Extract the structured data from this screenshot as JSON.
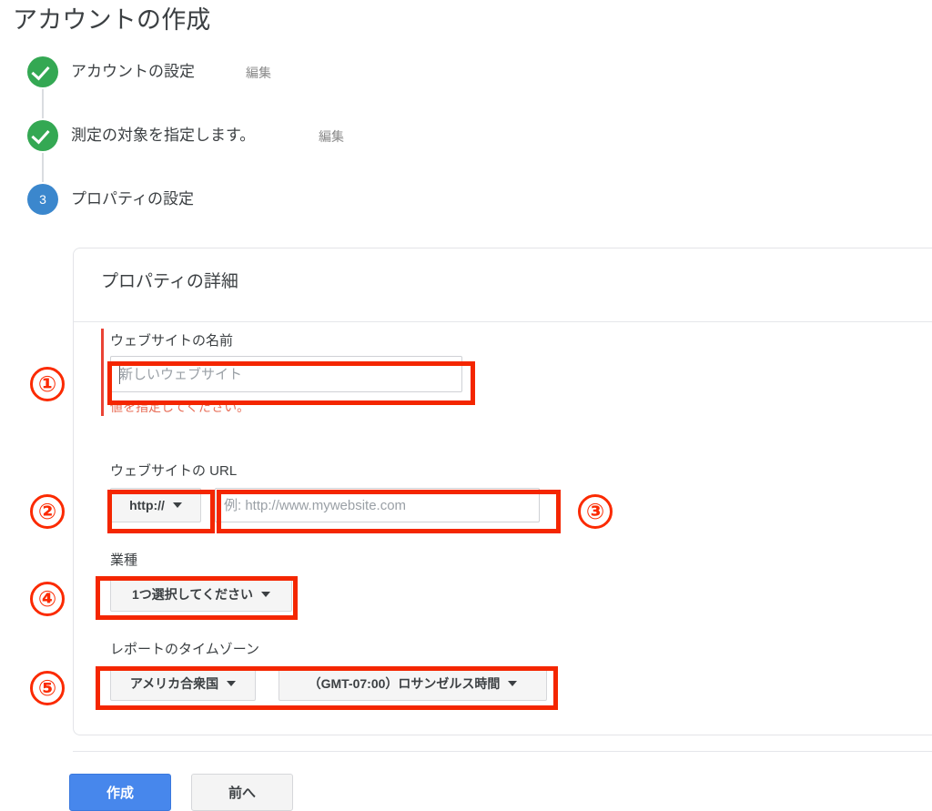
{
  "page": {
    "title": "アカウントの作成"
  },
  "stepper": {
    "steps": [
      {
        "marker": "check-icon",
        "number": "",
        "label": "アカウントの設定",
        "edit_label": "編集",
        "state": "done"
      },
      {
        "marker": "check-icon",
        "number": "",
        "label": "測定の対象を指定します。",
        "edit_label": "編集",
        "state": "done"
      },
      {
        "marker": "step-number",
        "number": "3",
        "label": "プロパティの設定",
        "edit_label": "",
        "state": "current"
      }
    ]
  },
  "card": {
    "title": "プロパティの詳細",
    "fields": {
      "site_name": {
        "label": "ウェブサイトの名前",
        "value": "",
        "placeholder": "新しいウェブサイト",
        "error": "値を指定してください。"
      },
      "site_url": {
        "label": "ウェブサイトの URL",
        "protocol_value": "http://",
        "value": "",
        "placeholder": "例: http://www.mywebsite.com"
      },
      "industry": {
        "label": "業種",
        "value": "1つ選択してください"
      },
      "timezone": {
        "label": "レポートのタイムゾーン",
        "country_value": "アメリカ合衆国",
        "zone_value": "（GMT-07:00）ロサンゼルス時間"
      }
    }
  },
  "footer": {
    "create_label": "作成",
    "back_label": "前へ"
  },
  "annotations": {
    "markers": [
      {
        "id": "1",
        "label": "①"
      },
      {
        "id": "2",
        "label": "②"
      },
      {
        "id": "3",
        "label": "③"
      },
      {
        "id": "4",
        "label": "④"
      },
      {
        "id": "5",
        "label": "⑤"
      }
    ]
  },
  "colors": {
    "step_done": "#34a853",
    "step_current": "#3b87cd",
    "primary_button": "#4787ec",
    "error": "#ea4335",
    "annotation": "#f42600"
  }
}
